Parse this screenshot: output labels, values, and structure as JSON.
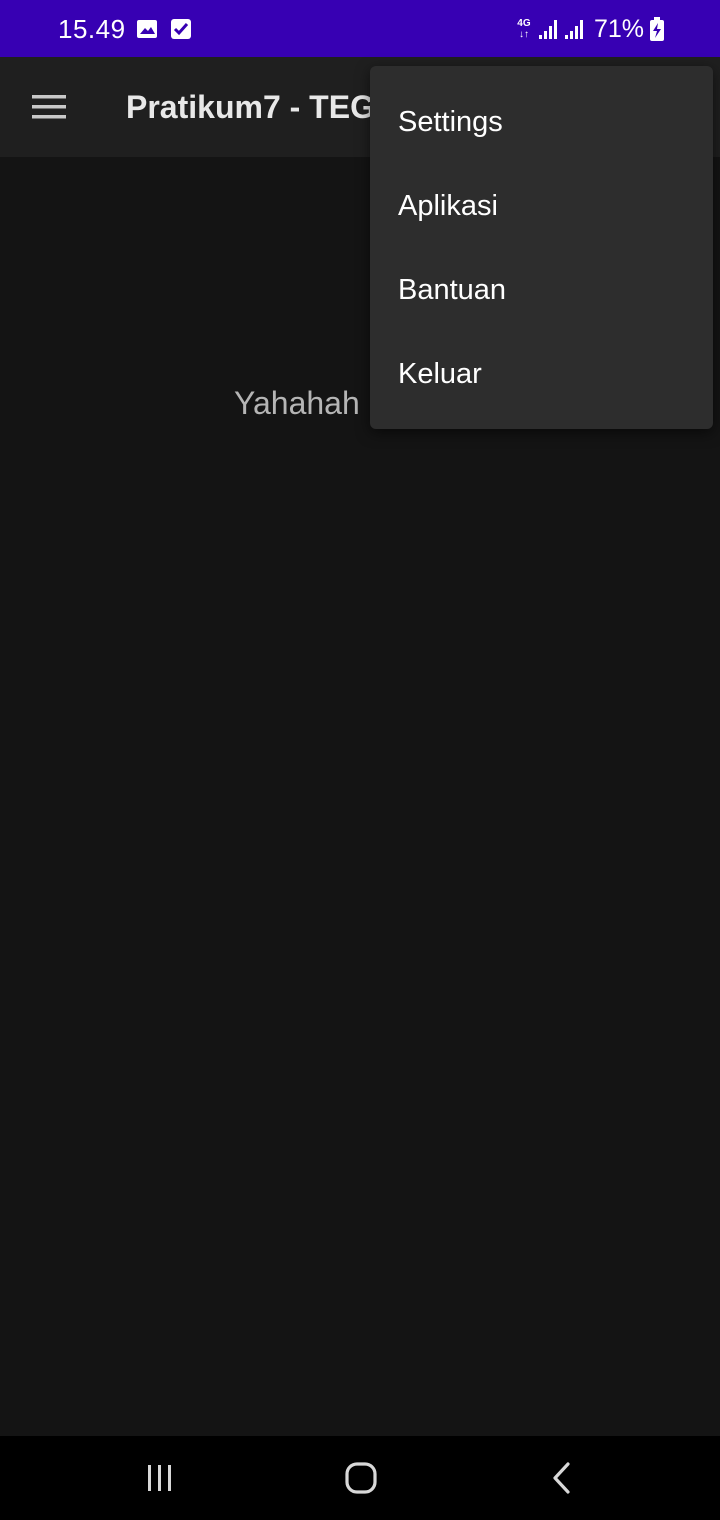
{
  "status_bar": {
    "time": "15.49",
    "network_type_top": "4G",
    "network_type_bottom": "↓↑",
    "battery_percent": "71%",
    "background_color": "#3700b3",
    "icons": [
      "gallery-icon",
      "checkbox-icon",
      "signal-icon",
      "signal-icon",
      "battery-charging-icon"
    ]
  },
  "app_bar": {
    "title": "Pratikum7 - TEG",
    "navigation_icon": "hamburger-menu-icon"
  },
  "main": {
    "text": "Yahahah"
  },
  "overflow_menu": {
    "items": [
      {
        "label": "Settings"
      },
      {
        "label": "Aplikasi"
      },
      {
        "label": "Bantuan"
      },
      {
        "label": "Keluar"
      }
    ]
  },
  "nav_bar": {
    "buttons": [
      "recent-apps-icon",
      "home-icon",
      "back-icon"
    ]
  }
}
